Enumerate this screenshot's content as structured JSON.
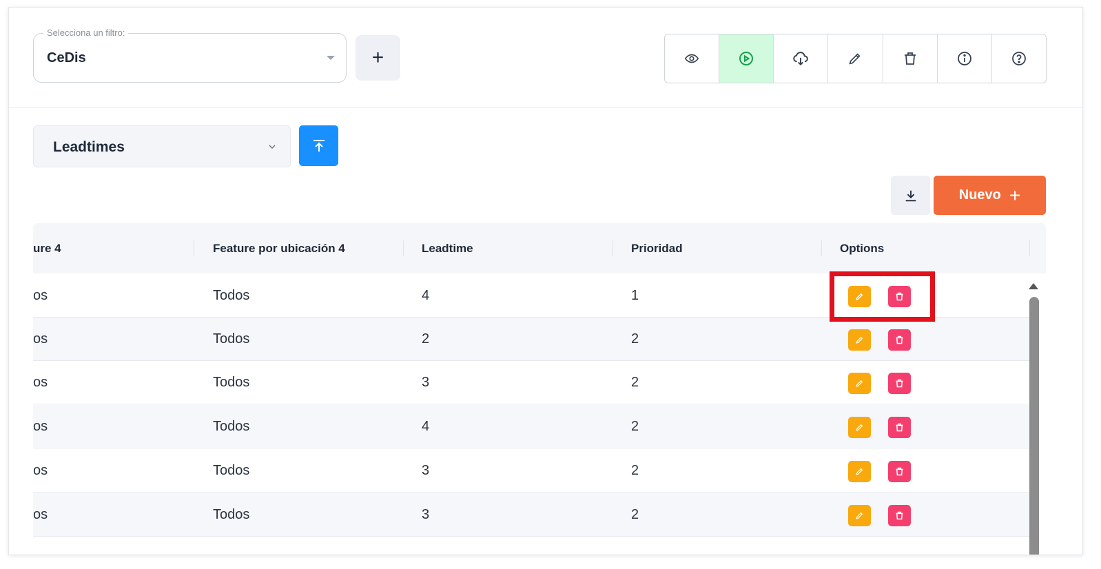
{
  "filter": {
    "legend": "Selecciona un filtro:",
    "value": "CeDis",
    "add_label": "+"
  },
  "toolbar": {
    "tools": [
      {
        "icon": "eye-icon",
        "active": false
      },
      {
        "icon": "play-circle-icon",
        "active": true
      },
      {
        "icon": "cloud-download-icon",
        "active": false
      },
      {
        "icon": "pencil-icon",
        "active": false
      },
      {
        "icon": "trash-icon",
        "active": false
      },
      {
        "icon": "info-icon",
        "active": false
      },
      {
        "icon": "help-icon",
        "active": false
      }
    ],
    "active_color": "#d1fadf"
  },
  "table_selector": {
    "value": "Leadtimes"
  },
  "actions": {
    "new_label": "Nuevo",
    "new_color": "#f26b3a",
    "upload_color": "#1890ff"
  },
  "table": {
    "columns": [
      "ure 4",
      "Feature por ubicación 4",
      "Leadtime",
      "Prioridad",
      "Options"
    ],
    "rows": [
      {
        "c0": "os",
        "c1": "Todos",
        "c2": "4",
        "c3": "1"
      },
      {
        "c0": "os",
        "c1": "Todos",
        "c2": "2",
        "c3": "2"
      },
      {
        "c0": "os",
        "c1": "Todos",
        "c2": "3",
        "c3": "2"
      },
      {
        "c0": "os",
        "c1": "Todos",
        "c2": "4",
        "c3": "2"
      },
      {
        "c0": "os",
        "c1": "Todos",
        "c2": "3",
        "c3": "2"
      },
      {
        "c0": "os",
        "c1": "Todos",
        "c2": "3",
        "c3": "2"
      }
    ],
    "edit_color": "#f9a90e",
    "delete_color": "#f43f6e",
    "highlight_color": "#e2111b"
  }
}
